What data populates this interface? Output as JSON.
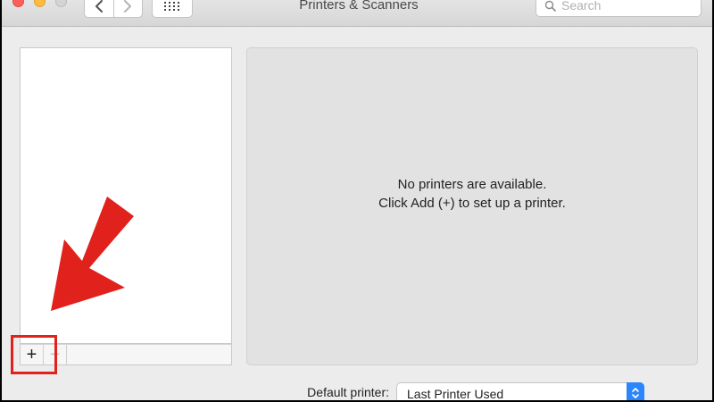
{
  "window": {
    "title": "Printers & Scanners"
  },
  "toolbar": {
    "back_icon": "chevron-left-icon",
    "forward_icon": "chevron-right-icon",
    "show_all_icon": "grid-icon",
    "search": {
      "placeholder": "Search",
      "value": ""
    }
  },
  "printer_list": {
    "items": [],
    "add_label": "+",
    "remove_label": "−"
  },
  "detail": {
    "empty_line1": "No printers are available.",
    "empty_line2": "Click Add (+) to set up a printer."
  },
  "default_printer": {
    "label": "Default printer:",
    "value": "Last Printer Used"
  },
  "annotation": {
    "highlight_color": "#e0211c",
    "arrow_color": "#e0211c"
  }
}
